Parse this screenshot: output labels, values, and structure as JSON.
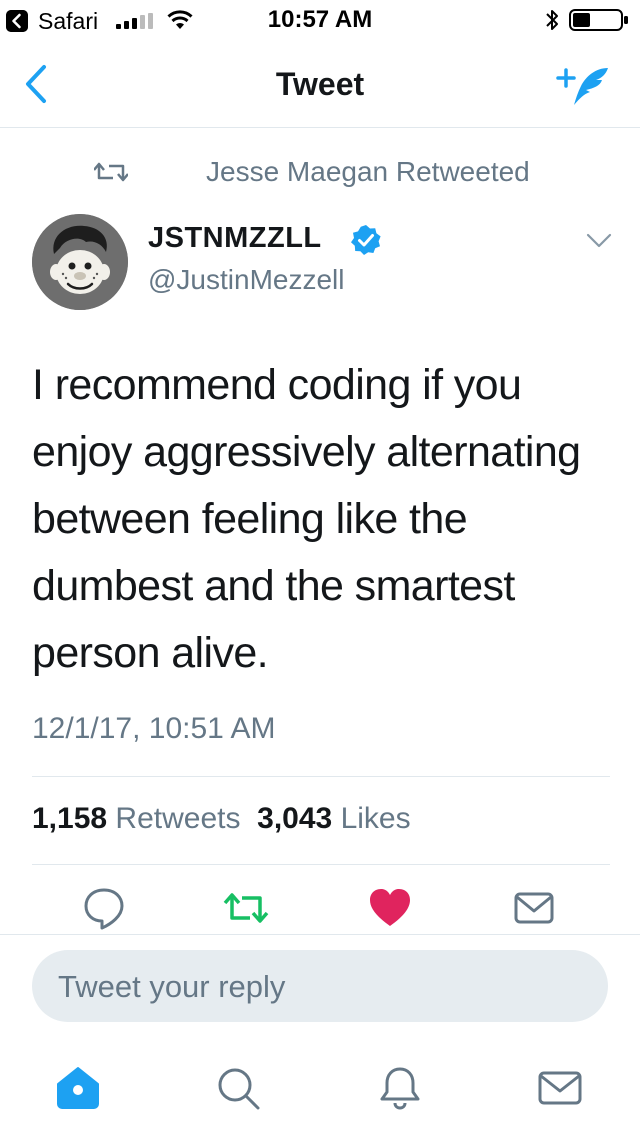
{
  "status_bar": {
    "app_name": "Safari",
    "time": "10:57 AM",
    "icons": [
      "back-to-app-icon",
      "signal-icon",
      "wifi-icon",
      "bluetooth-icon",
      "battery-icon"
    ]
  },
  "nav": {
    "title": "Tweet",
    "icons": [
      "back-chevron-icon",
      "compose-tweet-icon"
    ],
    "accent_color": "#1da1f2"
  },
  "retweet_context": {
    "text": "Jesse Maegan Retweeted",
    "icon": "retweet-icon"
  },
  "author": {
    "display_name": "JSTNMZZLL",
    "handle": "@JustinMezzell",
    "verified": true
  },
  "tweet": {
    "lines": [
      "I recommend coding if you",
      "enjoy aggressively alternating",
      "between feeling like the",
      "dumbest and the smartest",
      "person alive."
    ],
    "timestamp": "12/1/17, 10:51 AM"
  },
  "stats": {
    "retweets_count": "1,158",
    "retweets_label": "Retweets",
    "likes_count": "3,043",
    "likes_label": "Likes"
  },
  "actions": {
    "icons": [
      "reply-icon",
      "retweet-icon",
      "like-icon",
      "direct-message-icon"
    ],
    "retweet_color": "#17bf63",
    "like_color": "#e0245e"
  },
  "reply": {
    "placeholder": "Tweet your reply"
  },
  "tab_bar": {
    "icons": [
      "home-icon",
      "search-icon",
      "notifications-icon",
      "messages-icon"
    ]
  },
  "colors": {
    "text_primary": "#14171a",
    "text_secondary": "#657786",
    "divider": "#e1e8ed",
    "reply_background": "#e6ecf0"
  }
}
